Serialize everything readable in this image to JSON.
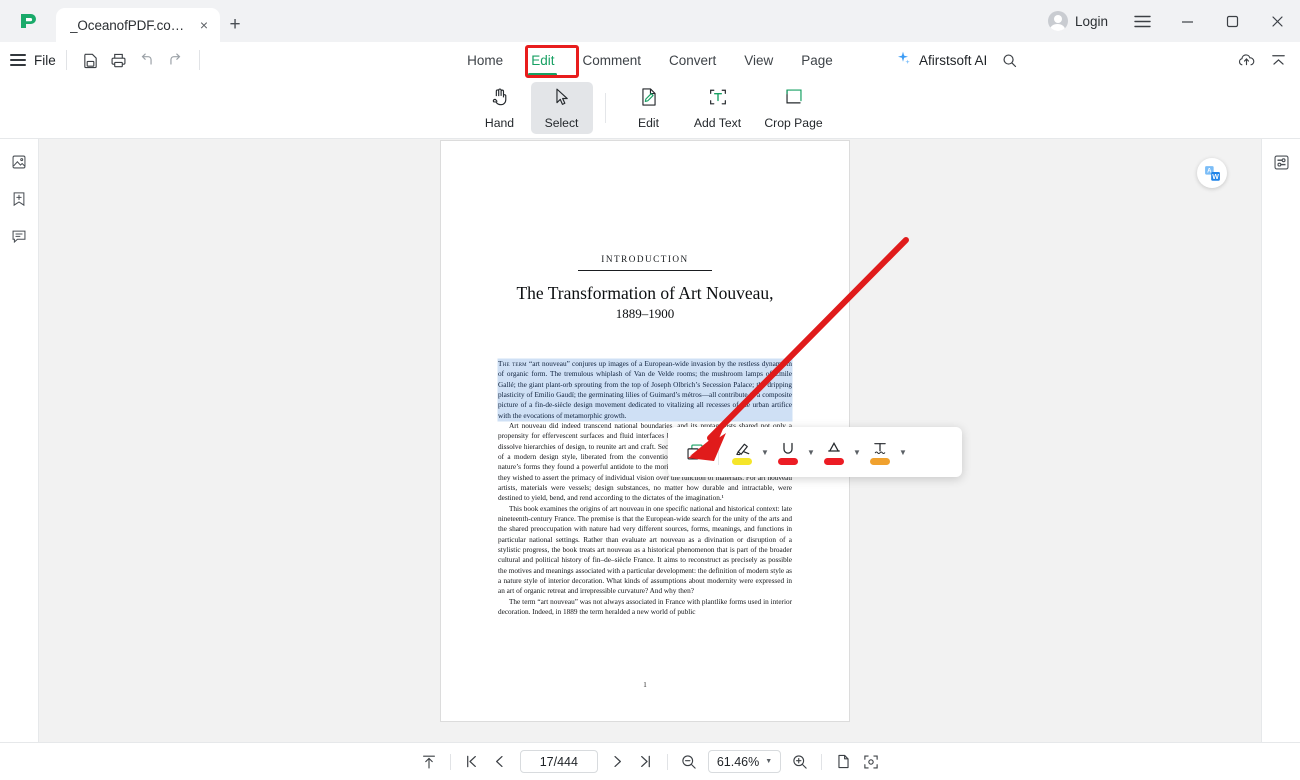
{
  "window": {
    "app_logo": "afirstsoft-logo",
    "tab": {
      "title": "_OceanofPDF.com_Art_...",
      "close": "×"
    },
    "new_tab": "+",
    "login_label": "Login",
    "menu_icon": "hamburger-icon",
    "minimize": "—",
    "maximize": "☐",
    "close": "✕"
  },
  "menubar": {
    "file_label": "File",
    "quick_actions": [
      {
        "name": "save-as-icon"
      },
      {
        "name": "print-icon"
      },
      {
        "name": "undo-icon"
      },
      {
        "name": "redo-icon"
      }
    ],
    "tabs": [
      {
        "label": "Home",
        "active": false
      },
      {
        "label": "Edit",
        "active": true
      },
      {
        "label": "Comment",
        "active": false
      },
      {
        "label": "Convert",
        "active": false
      },
      {
        "label": "View",
        "active": false
      },
      {
        "label": "Page",
        "active": false
      }
    ],
    "ai_label": "Afirstsoft AI",
    "search_icon": "search-icon",
    "cloud_upload_icon": "cloud-upload-icon",
    "collapse_icon": "collapse-ribbon-icon",
    "highlight_color": "#e81d1d",
    "active_color": "#17a063"
  },
  "ribbon": {
    "buttons": [
      {
        "label": "Hand",
        "icon": "hand-icon",
        "selected": false
      },
      {
        "label": "Select",
        "icon": "cursor-arrow-icon",
        "selected": true
      },
      {
        "label": "Edit",
        "icon": "edit-page-icon",
        "selected": false
      },
      {
        "label": "Add Text",
        "icon": "add-text-icon",
        "selected": false
      },
      {
        "label": "Crop Page",
        "icon": "crop-page-icon",
        "selected": false
      }
    ]
  },
  "left_rail": [
    {
      "name": "thumbnails-icon"
    },
    {
      "name": "bookmark-add-icon"
    },
    {
      "name": "comments-icon"
    }
  ],
  "right_rail": [
    {
      "name": "properties-panel-icon"
    }
  ],
  "viewer": {
    "translate_fab": "translate-icon",
    "document": {
      "kicker": "INTRODUCTION",
      "title": "The Transformation of Art Nouveau,",
      "dates": "1889–1900",
      "page_number": "1",
      "paragraphs": [
        {
          "selected": true,
          "indent": false,
          "lead": "The term",
          "text": " “art nouveau” conjures up images of a European-wide invasion by the restless dynamism of organic form. The tremulous whiplash of Van de Velde rooms; the mushroom lamps of Emile Gallé; the giant plant-orb sprouting from the top of Joseph Olbrich’s Secession Palace; the dripping plasticity of Emilio Gaudí; the germinating lilies of Guimard’s métros—all contribute to a composite picture of a fin-de-siècle design movement dedicated to vitalizing all recesses of the urban artifice with the evocations of metamorphic growth."
        },
        {
          "selected": false,
          "indent": true,
          "lead": "",
          "text": "Art nouveau did indeed transcend national boundaries, and its protagonists shared not only a propensity for effervescent surfaces and fluid interfaces but also three goals. First, they wanted to dissolve hierarchies of design, to reunite art and craft. Second, they sought to discover the essentials of a modern design style, liberated from the conventions of historicism. Third, in their turn to nature’s forms they found a powerful antidote to the moribund formulas of the period styles. Third, they wished to assert the primacy of individual vision over the function of materials. For art nouveau artists, materials were vessels; design substances, no matter how durable and intractable, were destined to yield, bend, and rend according to the dictates of the imagination.¹"
        },
        {
          "selected": false,
          "indent": true,
          "lead": "",
          "text": "This book examines the origins of art nouveau in one specific national and historical context: late nineteenth-century France. The premise is that the European-wide search for the unity of the arts and the shared preoccupation with nature had very different sources, forms, meanings, and functions in particular national settings. Rather than evaluate art nouveau as a divination or disruption of a stylistic progress, the book treats art nouveau as a historical phenomenon that is part of the broader cultural and political history of fin–de–siècle France. It aims to reconstruct as precisely as possible the motives and meanings associated with a particular development: the definition of modern style as a nature style of interior decoration. What kinds of assumptions about modernity were expressed in an art of organic retreat and irrepressible curvature? And why then?"
        },
        {
          "selected": false,
          "indent": true,
          "lead": "",
          "text": "The term “art nouveau” was not always associated in France with plantlike forms used in interior decoration. Indeed, in 1889 the term heralded a new world of public"
        }
      ]
    },
    "selection_toolbar": {
      "copy_icon": "copy-icon",
      "tools": [
        {
          "name": "highlight-tool",
          "icon": "highlighter-icon",
          "color": "#f5e52a",
          "caret": "▼"
        },
        {
          "name": "underline-tool",
          "icon": "underline-icon",
          "color": "#ec1c24",
          "caret": "▼"
        },
        {
          "name": "strikethrough-tool",
          "icon": "strikethrough-icon",
          "color": "#ec1c24",
          "caret": "▼"
        },
        {
          "name": "squiggly-underline-tool",
          "icon": "squiggly-underline-icon",
          "color": "#f0a12e",
          "caret": "▼"
        }
      ]
    },
    "annotation": {
      "arrow_color": "#e01b1b",
      "rect_color": "#e81d1d"
    }
  },
  "bottombar": {
    "scroll_top_icon": "scroll-to-top-icon",
    "first_page_icon": "first-page-icon",
    "prev_page_icon": "previous-page-icon",
    "page_value": "17/444",
    "next_page_icon": "next-page-icon",
    "last_page_icon": "last-page-icon",
    "zoom_out_icon": "zoom-out-icon",
    "zoom_value": "61.46%",
    "zoom_caret": "▼",
    "zoom_in_icon": "zoom-in-icon",
    "single_page_icon": "single-page-view-icon",
    "fit_page_icon": "fit-page-icon"
  }
}
